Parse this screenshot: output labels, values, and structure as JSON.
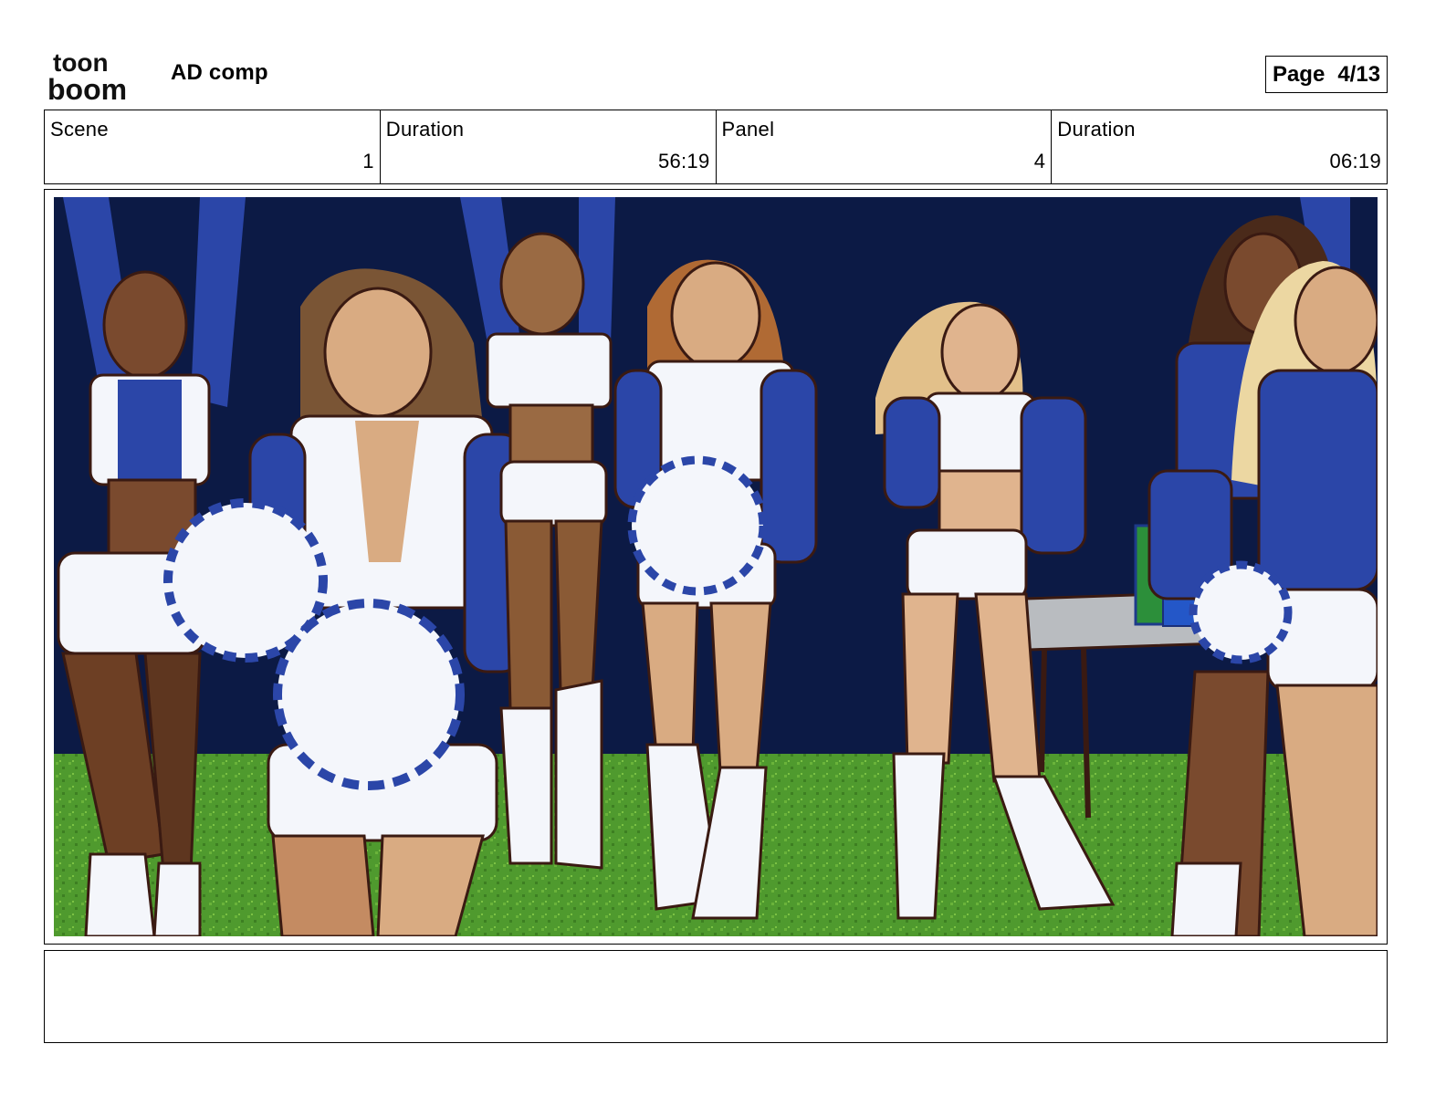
{
  "header": {
    "logo": {
      "line1": "toon",
      "line2": "boom",
      "icon": "toon-boom-logo"
    },
    "project_title": "AD comp",
    "page_label": "Page",
    "page_value": "4/13"
  },
  "info": {
    "scene_label": "Scene",
    "scene_value": "1",
    "scene_duration_label": "Duration",
    "scene_duration_value": "56:19",
    "panel_label": "Panel",
    "panel_value": "4",
    "panel_duration_label": "Duration",
    "panel_duration_value": "06:19"
  },
  "panel": {
    "colors": {
      "backdrop": "#0c1a45",
      "grass": "#4f9a2e",
      "uniform_blue": "#2b46a8",
      "uniform_white": "#f4f6fb",
      "outline": "#3a1a12",
      "table": "#b9bcc0"
    }
  },
  "notes": {
    "text": ""
  }
}
